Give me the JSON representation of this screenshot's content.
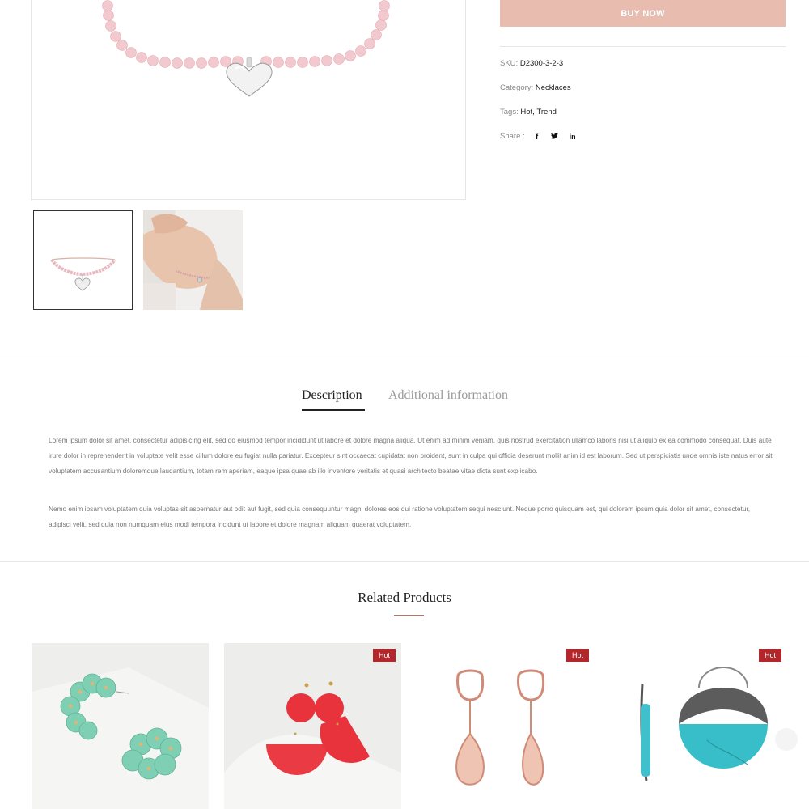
{
  "product": {
    "buy_now_label": "BUY NOW",
    "sku_label": "SKU:",
    "sku_value": "D2300-3-2-3",
    "category_label": "Category:",
    "category_value": "Necklaces",
    "tags_label": "Tags:",
    "tags": [
      "Hot",
      "Trend"
    ],
    "tag_separator": ",",
    "share_label": "Share :",
    "share_icons": [
      "facebook-icon",
      "twitter-icon",
      "linkedin-icon"
    ],
    "share_glyphs": {
      "facebook": "f",
      "twitter": "t",
      "linkedin": "in"
    },
    "accent_color": "#e8bdb0"
  },
  "tabs": [
    {
      "label": "Description",
      "active": true
    },
    {
      "label": "Additional information",
      "active": false
    }
  ],
  "description": {
    "para1": "Lorem ipsum dolor sit amet, consectetur adipisicing elit, sed do eiusmod tempor incididunt ut labore et dolore magna aliqua. Ut enim ad minim veniam, quis nostrud exercitation ullamco laboris nisi ut aliquip ex ea commodo consequat. Duis aute irure dolor in reprehenderit in voluptate velit esse cillum dolore eu fugiat nulla pariatur. Excepteur sint occaecat cupidatat non proident, sunt in culpa qui officia deserunt mollit anim id est laborum. Sed ut perspiciatis unde omnis iste natus error sit voluptatem accusantium doloremque laudantium, totam rem aperiam, eaque ipsa quae ab illo inventore veritatis et quasi architecto beatae vitae dicta sunt explicabo.",
    "para2": "Nemo enim ipsam voluptatem quia voluptas sit aspernatur aut odit aut fugit, sed quia consequuntur magni dolores eos qui ratione voluptatem sequi nesciunt. Neque porro quisquam est, qui dolorem ipsum quia dolor sit amet, consectetur, adipisci velit, sed quia non numquam eius modi tempora incidunt ut labore et dolore magnam aliquam quaerat voluptatem."
  },
  "related": {
    "title": "Related Products",
    "products": [
      {
        "badge": ""
      },
      {
        "badge": "Hot"
      },
      {
        "badge": "Hot"
      },
      {
        "badge": "Hot"
      }
    ],
    "badge_color": "#b3262b"
  }
}
